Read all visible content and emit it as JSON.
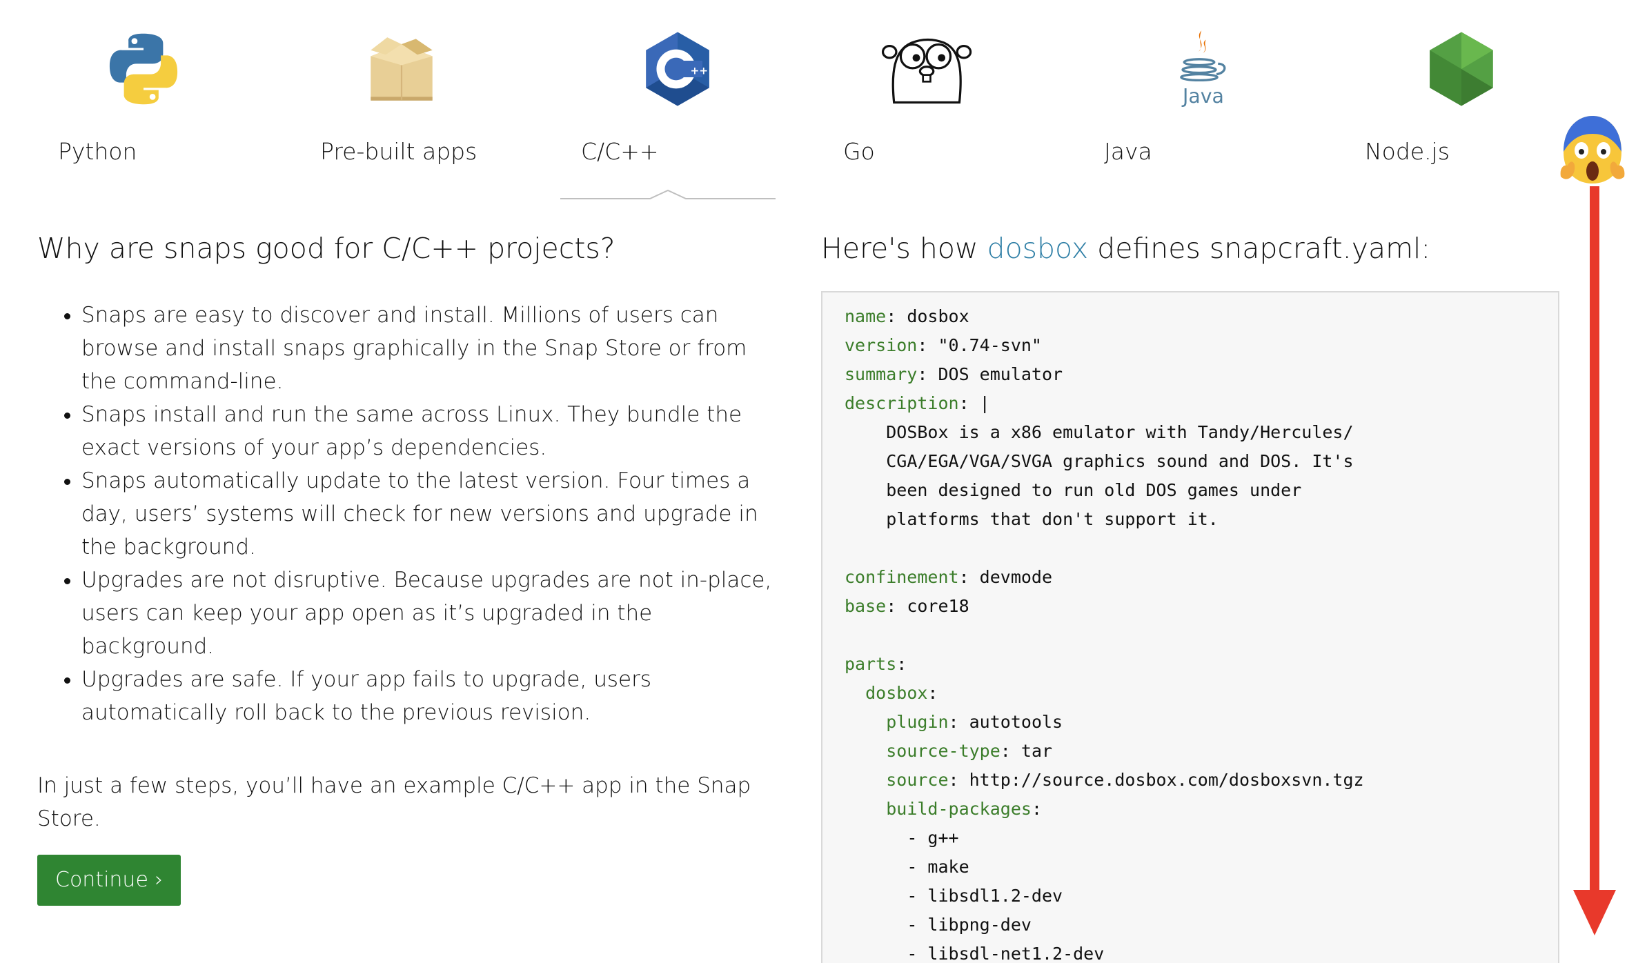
{
  "tabs": [
    {
      "label": "Python",
      "icon": "python-icon"
    },
    {
      "label": "Pre-built apps",
      "icon": "package-box-icon"
    },
    {
      "label": "C/C++",
      "icon": "cpp-icon",
      "selected": true
    },
    {
      "label": "Go",
      "icon": "go-gopher-icon"
    },
    {
      "label": "Java",
      "icon": "java-icon"
    },
    {
      "label": "Node.js",
      "icon": "nodejs-icon"
    }
  ],
  "left": {
    "title": "Why are snaps good for C/C++ projects?",
    "benefits": [
      "Snaps are easy to discover and install. Millions of users can browse and install snaps graphically in the Snap Store or from the command-line.",
      "Snaps install and run the same across Linux. They bundle the exact versions of your app’s dependencies.",
      "Snaps automatically update to the latest version. Four times a day, users’ systems will check for new versions and upgrade in the background.",
      "Upgrades are not disruptive. Because upgrades are not in-place, users can keep your app open as it’s upgraded in the background.",
      "Upgrades are safe. If your app fails to upgrade, users automatically roll back to the previous revision."
    ],
    "steps_text": "In just a few steps, you’ll have an example C/C++ app in the Snap Store.",
    "continue_label": "Continue ›"
  },
  "right": {
    "title_prefix": "Here's how ",
    "title_link": "dosbox",
    "title_suffix": " defines snapcraft.yaml:",
    "code_lines": [
      {
        "indent": "",
        "key": "name",
        "value": ": dosbox"
      },
      {
        "indent": "",
        "key": "version",
        "value": ": \"0.74-svn\""
      },
      {
        "indent": "",
        "key": "summary",
        "value": ": DOS emulator"
      },
      {
        "indent": "",
        "key": "description",
        "value": ": |"
      },
      {
        "indent": "    ",
        "key": "",
        "value": "DOSBox is a x86 emulator with Tandy/Hercules/"
      },
      {
        "indent": "    ",
        "key": "",
        "value": "CGA/EGA/VGA/SVGA graphics sound and DOS. It's"
      },
      {
        "indent": "    ",
        "key": "",
        "value": "been designed to run old DOS games under"
      },
      {
        "indent": "    ",
        "key": "",
        "value": "platforms that don't support it."
      },
      {
        "indent": "",
        "key": "",
        "value": ""
      },
      {
        "indent": "",
        "key": "confinement",
        "value": ": devmode"
      },
      {
        "indent": "",
        "key": "base",
        "value": ": core18"
      },
      {
        "indent": "",
        "key": "",
        "value": ""
      },
      {
        "indent": "",
        "key": "parts",
        "value": ":"
      },
      {
        "indent": "  ",
        "key": "dosbox",
        "value": ":"
      },
      {
        "indent": "    ",
        "key": "plugin",
        "value": ": autotools"
      },
      {
        "indent": "    ",
        "key": "source-type",
        "value": ": tar"
      },
      {
        "indent": "    ",
        "key": "source",
        "value": ": http://source.dosbox.com/dosboxsvn.tgz"
      },
      {
        "indent": "    ",
        "key": "build-packages",
        "value": ":"
      },
      {
        "indent": "      ",
        "key": "",
        "value": "- g++"
      },
      {
        "indent": "      ",
        "key": "",
        "value": "- make"
      },
      {
        "indent": "      ",
        "key": "",
        "value": "- libsdl1.2-dev"
      },
      {
        "indent": "      ",
        "key": "",
        "value": "- libpng-dev"
      },
      {
        "indent": "      ",
        "key": "",
        "value": "- libsdl-net1.2-dev"
      }
    ]
  },
  "annotation": {
    "emoji": "screaming-face-emoji",
    "arrow": "down-arrow",
    "arrow_color": "#e8392b"
  },
  "colors": {
    "accent_link": "#2f7fa6",
    "button_green": "#2f8532",
    "code_key": "#3b7d2a",
    "code_bg": "#f7f7f7"
  }
}
